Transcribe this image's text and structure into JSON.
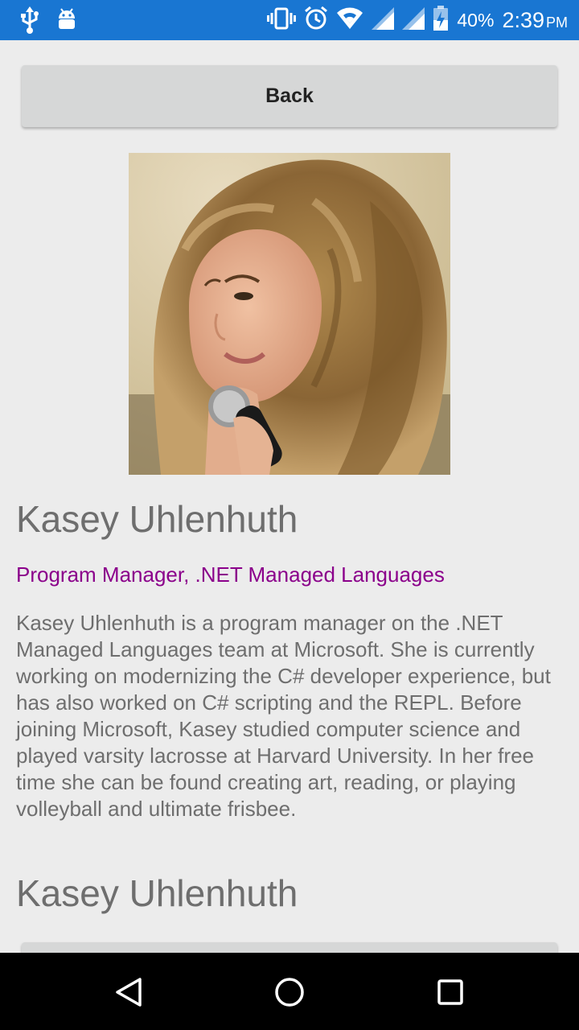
{
  "status_bar": {
    "battery": "40%",
    "time": "2:39",
    "ampm": "PM",
    "icons": [
      "usb-icon",
      "android-debug-icon",
      "vibrate-icon",
      "alarm-icon",
      "wifi-icon",
      "signal-icon",
      "signal-icon",
      "battery-charging-icon"
    ]
  },
  "back_button": {
    "label": "Back"
  },
  "profile": {
    "name": "Kasey Uhlenhuth",
    "title": "Program Manager, .NET Managed Languages",
    "bio": "Kasey Uhlenhuth is a program manager on the .NET Managed Languages team at Microsoft. She is currently working on modernizing the C# developer experience, but has also worked on C# scripting and the REPL. Before joining Microsoft, Kasey studied computer science and played varsity lacrosse at Harvard University. In her free time she can be found creating art, reading, or playing volleyball and ultimate frisbee.",
    "name_repeat": "Kasey Uhlenhuth"
  },
  "colors": {
    "status_bar": "#1976d2",
    "background": "#ececec",
    "title_accent": "#8b008b",
    "text_gray": "#6e6e6e",
    "button": "#d6d7d7"
  },
  "nav_bar": {
    "icons": [
      "back-triangle-icon",
      "home-circle-icon",
      "recents-square-icon"
    ]
  }
}
